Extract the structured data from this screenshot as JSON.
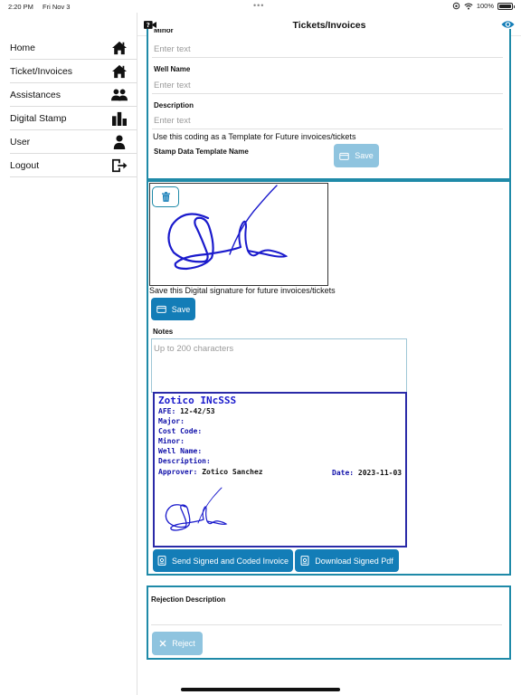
{
  "status_bar": {
    "time": "2:20 PM",
    "date": "Fri Nov 3",
    "battery": "100%"
  },
  "header": {
    "title": "Tickets/Invoices"
  },
  "sidebar": {
    "items": [
      {
        "label": "Home",
        "icon": "home-icon"
      },
      {
        "label": "Ticket/Invoices",
        "icon": "home-icon"
      },
      {
        "label": "Assistances",
        "icon": "users-icon"
      },
      {
        "label": "Digital Stamp",
        "icon": "chart-icon"
      },
      {
        "label": "User",
        "icon": "user-icon"
      },
      {
        "label": "Logout",
        "icon": "logout-icon"
      }
    ]
  },
  "form": {
    "minor_label": "Minor",
    "minor_placeholder": "Enter text",
    "well_name_label": "Well Name",
    "well_name_placeholder": "Enter text",
    "description_label": "Description",
    "description_placeholder": "Enter text",
    "template_text": "Use this coding as a Template for Future invoices/tickets",
    "template_name_label": "Stamp Data Template Name",
    "save_template_label": "Save"
  },
  "signature": {
    "save_text": "Save this Digital signature for future invoices/tickets",
    "save_label": "Save",
    "notes_label": "Notes",
    "notes_placeholder": "Up to 200 characters"
  },
  "stamp": {
    "company": "Zotico INcSSS",
    "afe_label": "AFE:",
    "afe_value": "12-42/53",
    "major_label": "Major:",
    "cost_code_label": "Cost Code:",
    "minor_label": "Minor:",
    "well_name_label": "Well Name:",
    "description_label": "Description:",
    "approver_label": "Approver:",
    "approver_value": "Zotico Sanchez",
    "date_label": "Date:",
    "date_value": "2023-11-03"
  },
  "actions": {
    "send_label": "Send Signed and Coded Invoice",
    "download_label": "Download Signed Pdf"
  },
  "rejection": {
    "label": "Rejection Description",
    "reject_label": "Reject"
  },
  "colors": {
    "accent": "#137db7",
    "border": "#1f8aa8",
    "stamp": "#2a2aa8",
    "signature": "#1a1acc"
  }
}
